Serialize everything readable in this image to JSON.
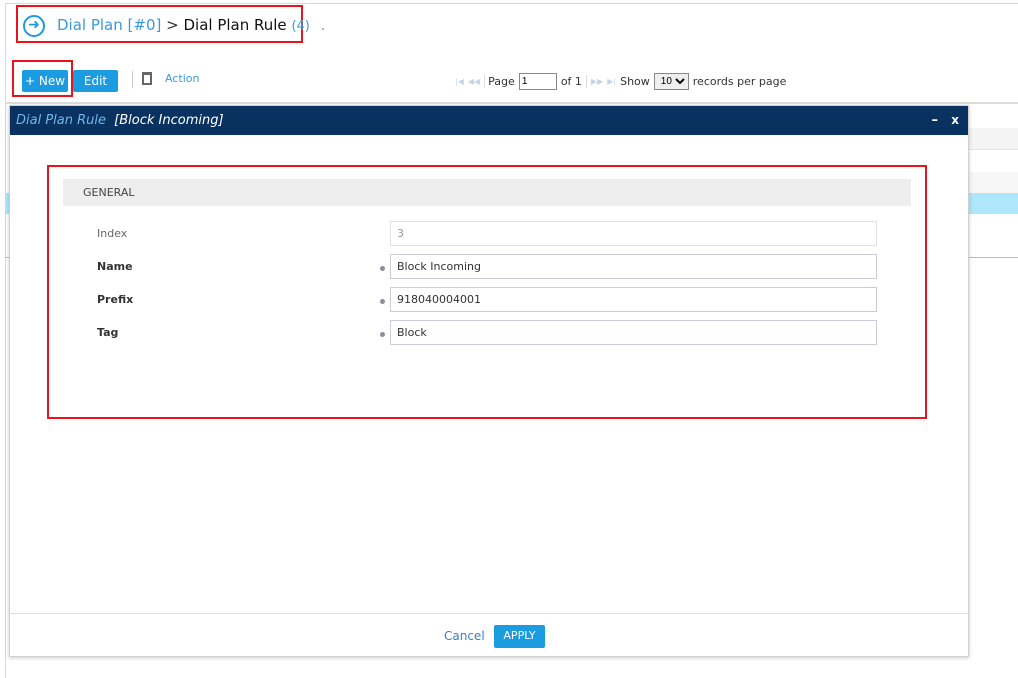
{
  "breadcrumb": {
    "parent": "Dial Plan [#0]",
    "separator": ">",
    "current": "Dial Plan Rule",
    "count": "(4)",
    "trailing": "."
  },
  "toolbar": {
    "new_label": "+ New",
    "edit_label": "Edit",
    "action_label": "Action"
  },
  "pager": {
    "page_label": "Page",
    "page_value": "1",
    "of_label": "of 1",
    "show_label": "Show",
    "per_page": "10",
    "records_label": "records per page"
  },
  "dialog": {
    "title": "Dial Plan Rule",
    "subtitle": "[Block Incoming]",
    "minimize": "–",
    "close": "x",
    "section": "GENERAL",
    "fields": [
      {
        "label": "Index",
        "value": "3",
        "required": false,
        "readonly": true
      },
      {
        "label": "Name",
        "value": "Block Incoming",
        "required": true
      },
      {
        "label": "Prefix",
        "value": "918040004001",
        "required": true
      },
      {
        "label": "Tag",
        "value": "Block",
        "required": true
      }
    ],
    "cancel_label": "Cancel",
    "apply_label": "APPLY"
  },
  "colors": {
    "accent": "#1b9be0",
    "header": "#0a3260",
    "highlight": "#e8141c",
    "selected_row": "#aee6fb"
  }
}
